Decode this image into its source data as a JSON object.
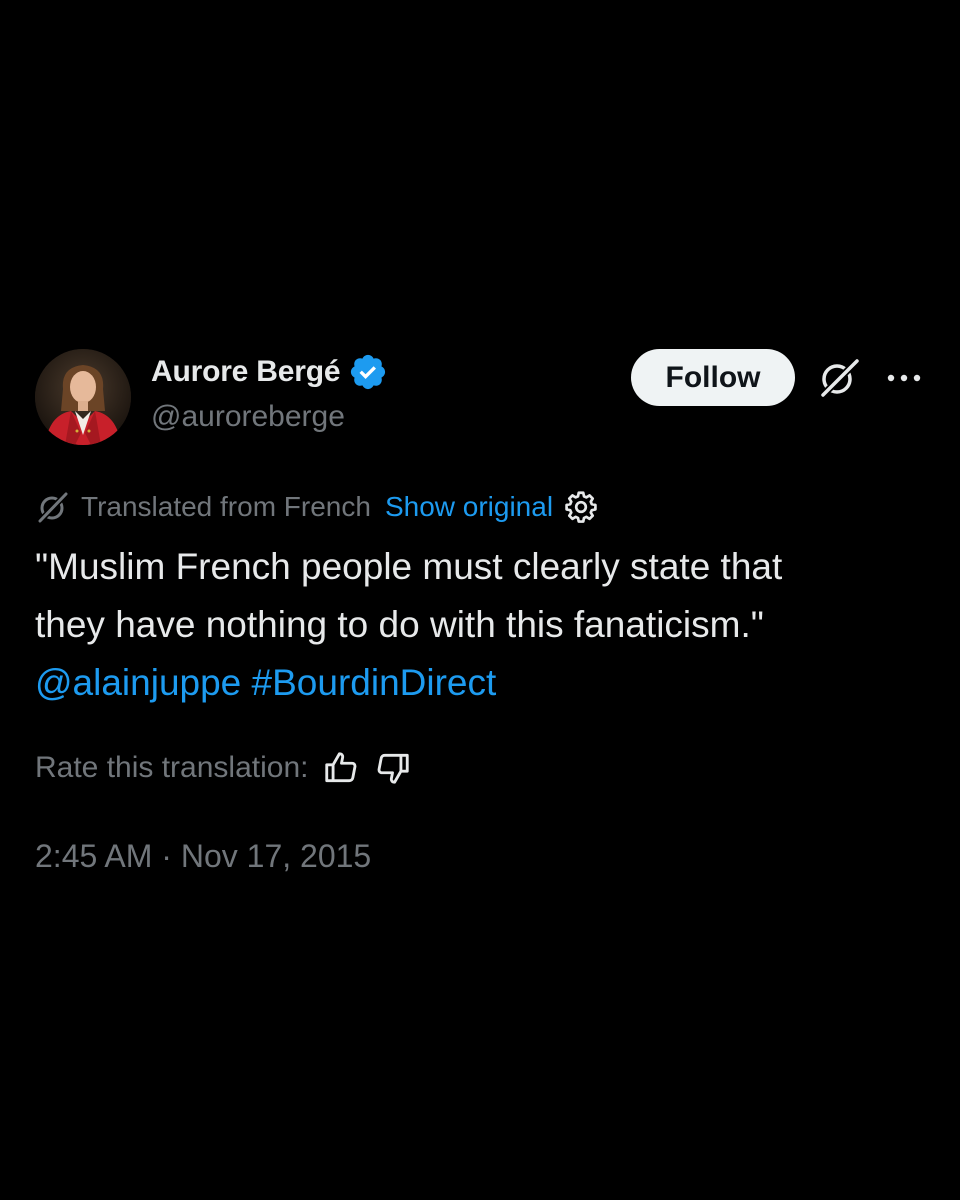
{
  "author": {
    "display_name": "Aurore Bergé",
    "handle": "@auroreberge",
    "verified": true,
    "verified_color": "#1d9bf0"
  },
  "actions": {
    "follow_label": "Follow",
    "grok_icon": "grok-icon",
    "more_icon": "more-icon"
  },
  "translation": {
    "translated_from": "Translated from French",
    "show_original": "Show original",
    "settings_icon": "gear-icon"
  },
  "tweet": {
    "line1": "\"Muslim French people must clearly state that",
    "line2": "they have nothing to do with this fanaticism.\"",
    "mention": "@alainjuppe",
    "hashtag": "#BourdinDirect"
  },
  "rating": {
    "label": "Rate this translation:",
    "up_icon": "thumbs-up-icon",
    "down_icon": "thumbs-down-icon"
  },
  "meta": {
    "timestamp": "2:45 AM · Nov 17, 2015"
  },
  "colors": {
    "background": "#000000",
    "text": "#e7e9ea",
    "muted": "#71767b",
    "link": "#1d9bf0",
    "button_bg": "#eff3f4"
  }
}
